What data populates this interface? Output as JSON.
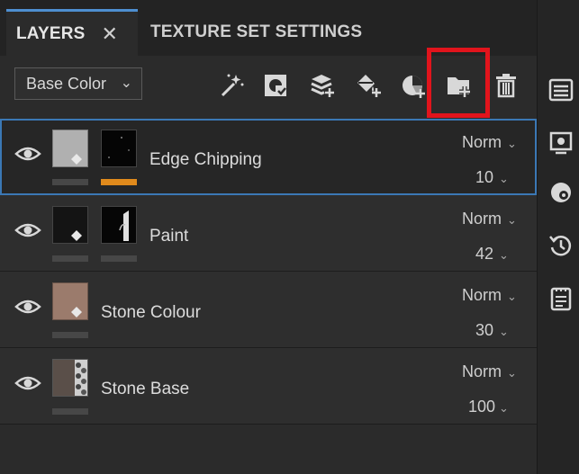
{
  "tabs": {
    "layers_label": "LAYERS",
    "layers_close": "✕",
    "texture_set_label": "TEXTURE SET SETTINGS"
  },
  "toolbar": {
    "channel_select": "Base Color",
    "channel_chevron": "⌄",
    "tools": [
      "magic-wand-icon",
      "add-mask-icon",
      "add-layer-icon",
      "add-fill-layer-icon",
      "add-effect-icon",
      "add-folder-icon",
      "delete-icon"
    ]
  },
  "layers": [
    {
      "name": "Edge Chipping",
      "blend": "Norm",
      "opacity": "10",
      "selected": true
    },
    {
      "name": "Paint",
      "blend": "Norm",
      "opacity": "42",
      "selected": false
    },
    {
      "name": "Stone Colour",
      "blend": "Norm",
      "opacity": "30",
      "selected": false
    },
    {
      "name": "Stone Base",
      "blend": "Norm",
      "opacity": "100",
      "selected": false
    }
  ],
  "rightbar": [
    "list-icon",
    "camera-settings-icon",
    "display-settings-icon",
    "history-icon",
    "notes-icon"
  ],
  "colors": {
    "accent": "#3b78b5",
    "highlight": "#e1141c",
    "mask_bar": "#e08a1c"
  }
}
